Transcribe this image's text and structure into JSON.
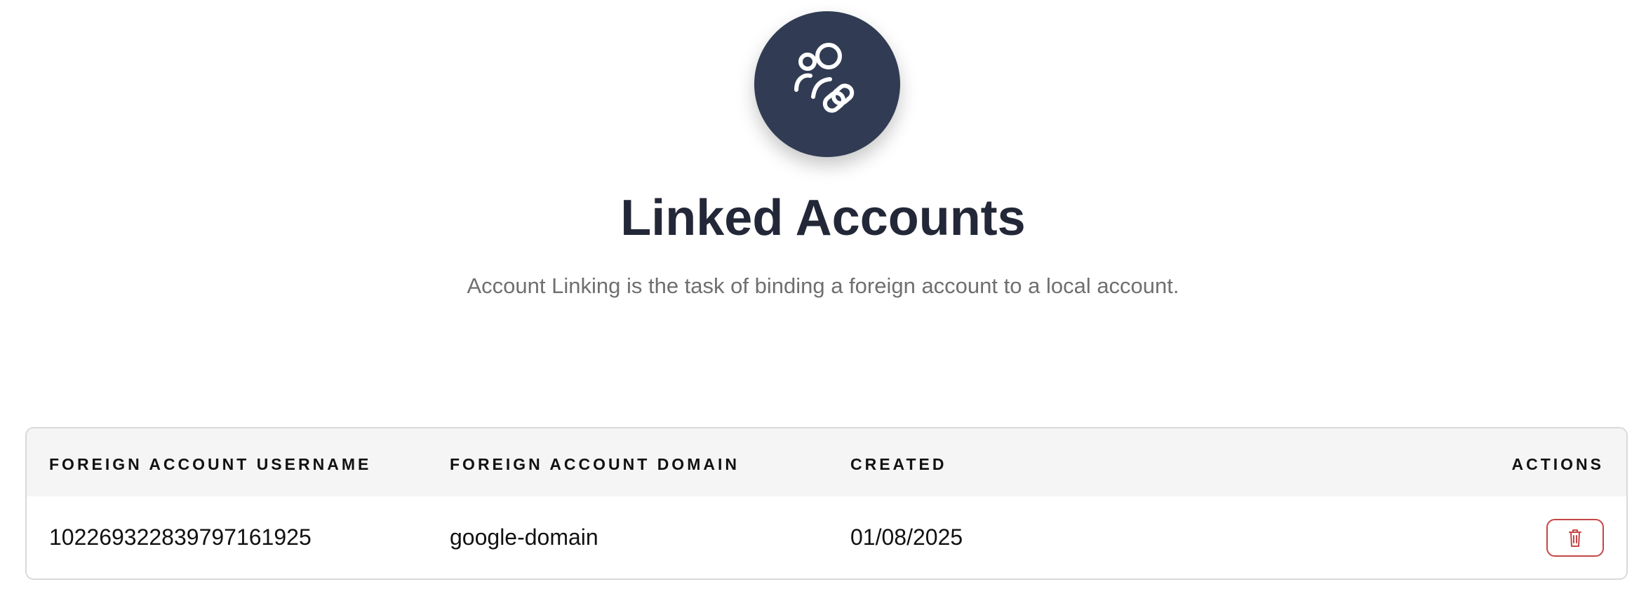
{
  "header": {
    "icon": "account-link-icon",
    "title": "Linked Accounts",
    "subtitle": "Account Linking is the task of binding a foreign account to a local account."
  },
  "table": {
    "columns": [
      "FOREIGN ACCOUNT USERNAME",
      "FOREIGN ACCOUNT DOMAIN",
      "CREATED",
      "ACTIONS"
    ],
    "rows": [
      {
        "username": "102269322839797161925",
        "domain": "google-domain",
        "created": "01/08/2025",
        "action_icon": "trash-icon"
      }
    ]
  },
  "colors": {
    "icon_background": "#313c54",
    "title": "#232838",
    "subtitle": "#6f6f6f",
    "delete_accent": "#c54646"
  }
}
